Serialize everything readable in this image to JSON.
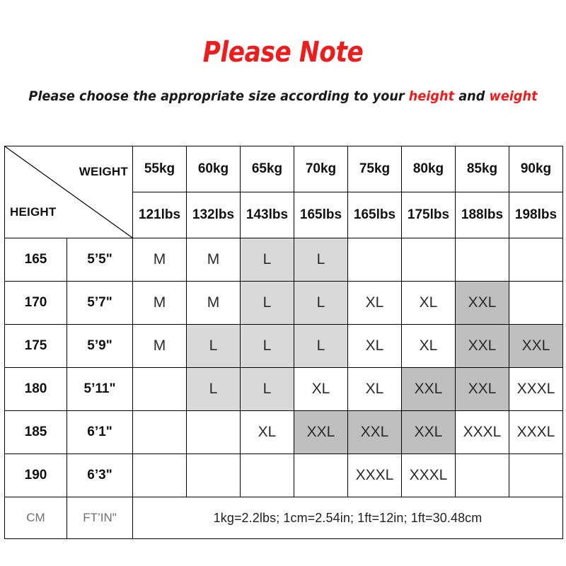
{
  "heading": {
    "title": "Please Note",
    "subtitle_parts": [
      {
        "text": "Please choose the appropriate size according to your ",
        "accent": false
      },
      {
        "text": "height",
        "accent": true
      },
      {
        "text": " and ",
        "accent": false
      },
      {
        "text": "weight",
        "accent": true
      }
    ],
    "subtitle_lead": "Please choose the appropriate size according to your ",
    "subtitle_height": "height",
    "subtitle_and": " and ",
    "subtitle_weight": "weight",
    "accent_color": "#ee1c1c"
  },
  "table": {
    "corner": {
      "weight_label": "WEIGHT",
      "height_label": "HEIGHT"
    },
    "weight_kg": [
      "55kg",
      "60kg",
      "65kg",
      "70kg",
      "75kg",
      "80kg",
      "85kg",
      "90kg"
    ],
    "weight_lbs": [
      "121lbs",
      "132lbs",
      "143lbs",
      "165lbs",
      "165lbs",
      "175lbs",
      "188lbs",
      "198lbs"
    ],
    "rows": [
      {
        "cm": "165",
        "ft": "5’5\"",
        "sizes": [
          "M",
          "M",
          "L",
          "L",
          "",
          "",
          "",
          ""
        ],
        "shades": [
          "none",
          "none",
          "light",
          "light",
          "none",
          "none",
          "none",
          "none"
        ]
      },
      {
        "cm": "170",
        "ft": "5’7\"",
        "sizes": [
          "M",
          "M",
          "L",
          "L",
          "XL",
          "XL",
          "XXL",
          ""
        ],
        "shades": [
          "none",
          "none",
          "light",
          "light",
          "none",
          "none",
          "dark",
          "none"
        ]
      },
      {
        "cm": "175",
        "ft": "5’9\"",
        "sizes": [
          "M",
          "L",
          "L",
          "L",
          "XL",
          "XL",
          "XXL",
          "XXL"
        ],
        "shades": [
          "none",
          "light",
          "light",
          "light",
          "none",
          "none",
          "dark",
          "dark"
        ]
      },
      {
        "cm": "180",
        "ft": "5’11\"",
        "sizes": [
          "",
          "L",
          "L",
          "XL",
          "XL",
          "XXL",
          "XXL",
          "XXXL"
        ],
        "shades": [
          "none",
          "light",
          "light",
          "none",
          "none",
          "dark",
          "dark",
          "none"
        ]
      },
      {
        "cm": "185",
        "ft": "6’1\"",
        "sizes": [
          "",
          "",
          "XL",
          "XXL",
          "XXL",
          "XXL",
          "XXXL",
          "XXXL"
        ],
        "shades": [
          "none",
          "none",
          "none",
          "dark",
          "dark",
          "dark",
          "none",
          "none"
        ]
      },
      {
        "cm": "190",
        "ft": "6’3\"",
        "sizes": [
          "",
          "",
          "",
          "",
          "XXXL",
          "XXXL",
          "",
          ""
        ],
        "shades": [
          "none",
          "none",
          "none",
          "none",
          "none",
          "none",
          "none",
          "none"
        ]
      }
    ],
    "footer": {
      "unit_cm": "CM",
      "unit_ft": "FT’IN\"",
      "note": "1kg=2.2lbs; 1cm=2.54in; 1ft=12in; 1ft=30.48cm"
    },
    "shade_colors": {
      "light": "#d9d9d9",
      "dark": "#bfbfbf"
    }
  }
}
